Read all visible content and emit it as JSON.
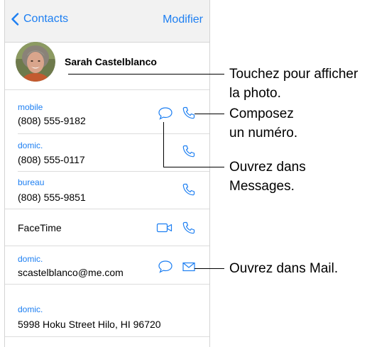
{
  "nav": {
    "back_label": "Contacts",
    "edit_label": "Modifier"
  },
  "contact": {
    "name": "Sarah Castelblanco"
  },
  "fields": {
    "mobile": {
      "label": "mobile",
      "value": "(808) 555-9182"
    },
    "home_phone": {
      "label": "domic.",
      "value": "(808) 555-0117"
    },
    "work_phone": {
      "label": "bureau",
      "value": "(808) 555-9851"
    },
    "facetime": {
      "label": "FaceTime"
    },
    "email": {
      "label": "domic.",
      "value": "scastelblanco@me.com"
    },
    "address": {
      "label": "domic.",
      "value": "5998 Hoku Street Hilo, HI 96720"
    }
  },
  "callouts": {
    "photo_line1": "Touchez pour afficher",
    "photo_line2": "la photo.",
    "call_line1": "Composez",
    "call_line2": "un numéro.",
    "message_line1": "Ouvrez dans",
    "message_line2": "Messages.",
    "mail": "Ouvrez dans Mail."
  },
  "colors": {
    "accent": "#1d7ff2",
    "background": "#f2f2f2"
  },
  "icons": [
    "chevron-left-icon",
    "speech-bubble-icon",
    "phone-icon",
    "video-camera-icon",
    "envelope-icon"
  ]
}
